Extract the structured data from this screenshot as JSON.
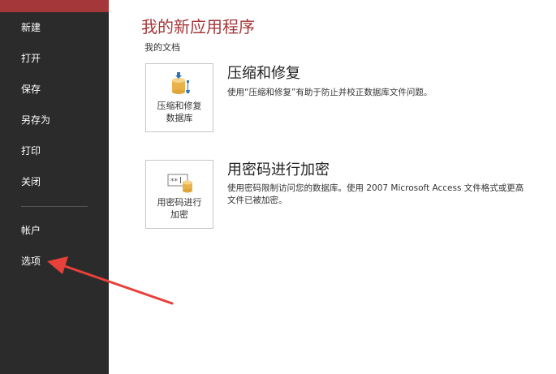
{
  "sidebar": {
    "items": [
      {
        "label": "新建"
      },
      {
        "label": "打开"
      },
      {
        "label": "保存"
      },
      {
        "label": "另存为"
      },
      {
        "label": "打印"
      },
      {
        "label": "关闭"
      },
      {
        "label": "帐户"
      },
      {
        "label": "选项"
      }
    ],
    "active_color": "#a4373a",
    "background": "#2b2b2b"
  },
  "main": {
    "title": "我的新应用程序",
    "path": "我的文档",
    "commands": [
      {
        "tile_line1": "压缩和修复",
        "tile_line2": "数据库",
        "title": "压缩和修复",
        "desc_line1": "使用“压缩和修复”有助于防止并校正数据库文件问题。",
        "icon": "compact-repair-icon"
      },
      {
        "tile_line1": "用密码进行",
        "tile_line2": "加密",
        "title": "用密码进行加密",
        "desc_line1": "使用密码限制访问您的数据库。使用 2007 Microsoft Access 文件格式或更高",
        "desc_line2": "文件已被加密。",
        "icon": "encrypt-password-icon"
      }
    ]
  },
  "annotation": {
    "color": "#e8403a",
    "icon": "red-arrow-annotation"
  }
}
